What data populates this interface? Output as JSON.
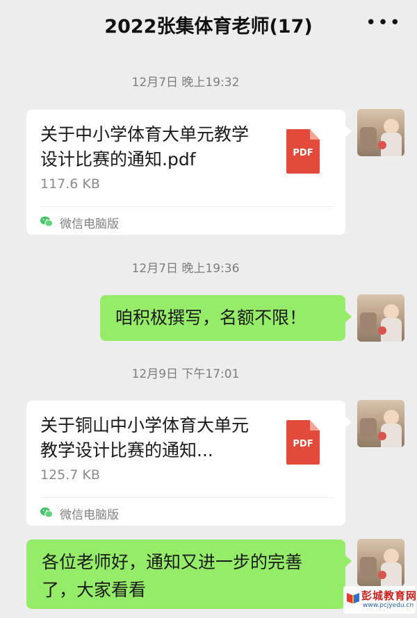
{
  "header": {
    "title": "2022张集体育老师(17)",
    "more_icon": "more-dots-icon"
  },
  "messages": [
    {
      "type": "time",
      "text": "12月7日 晚上19:32"
    },
    {
      "type": "file",
      "file_name": "关于中小学体育大单元教学设计比赛的通知.pdf",
      "file_size": "117.6 KB",
      "file_badge": "PDF",
      "source": "微信电脑版"
    },
    {
      "type": "time",
      "text": "12月7日 晚上19:36"
    },
    {
      "type": "text",
      "text": "咱积极撰写，名额不限！"
    },
    {
      "type": "time",
      "text": "12月9日 下午17:01"
    },
    {
      "type": "file",
      "file_name": "关于铜山中小学体育大单元教学设计比赛的通知...",
      "file_size": "125.7 KB",
      "file_badge": "PDF",
      "source": "微信电脑版"
    },
    {
      "type": "text",
      "text": "各位老师好，通知又进一步的完善了，大家看看"
    }
  ],
  "watermark": {
    "name": "彭城教育网",
    "url": "www.pcjyedu.cn"
  },
  "colors": {
    "background": "#ededed",
    "sent_bubble": "#95ec69",
    "pdf_red": "#e24b3b"
  }
}
